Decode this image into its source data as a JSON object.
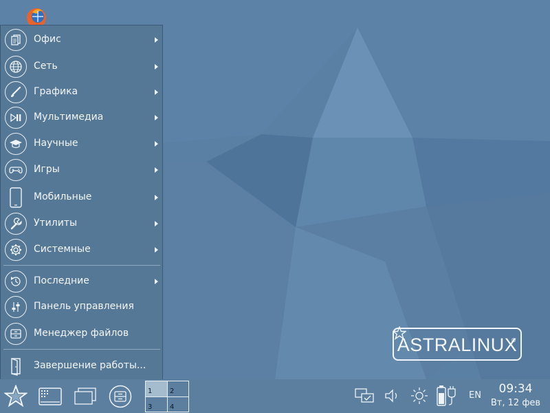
{
  "desktop": {
    "firefox_icon": "firefox-icon",
    "logo": {
      "text": "ASTRALINUX",
      "reg": "®"
    }
  },
  "start_menu": {
    "categories": [
      {
        "label": "Офис",
        "icon": "office-icon"
      },
      {
        "label": "Сеть",
        "icon": "globe-icon"
      },
      {
        "label": "Графика",
        "icon": "brush-icon"
      },
      {
        "label": "Мультимедиа",
        "icon": "multimedia-icon"
      },
      {
        "label": "Научные",
        "icon": "graduation-cap-icon"
      },
      {
        "label": "Игры",
        "icon": "gamepad-icon"
      },
      {
        "label": "Мобильные",
        "icon": "phone-icon"
      },
      {
        "label": "Утилиты",
        "icon": "wrench-icon"
      },
      {
        "label": "Системные",
        "icon": "gear-icon"
      }
    ],
    "recent": {
      "label": "Последние",
      "icon": "history-icon"
    },
    "control_panel": {
      "label": "Панель управления",
      "icon": "sliders-icon"
    },
    "file_manager": {
      "label": "Менеджер файлов",
      "icon": "file-cabinet-icon"
    },
    "shutdown": {
      "label": "Завершение работы...",
      "icon": "exit-door-icon"
    }
  },
  "taskbar": {
    "pager": [
      "1",
      "2",
      "3",
      "4"
    ],
    "active_desktop": "1",
    "language": "EN",
    "time": "09:34",
    "date": "Вт, 12 фев"
  },
  "colors": {
    "wallpaper": "#5c83a7",
    "menu_bg": "#557897",
    "taskbar_bg": "#5c7fa0",
    "text": "#f3f6f9"
  }
}
